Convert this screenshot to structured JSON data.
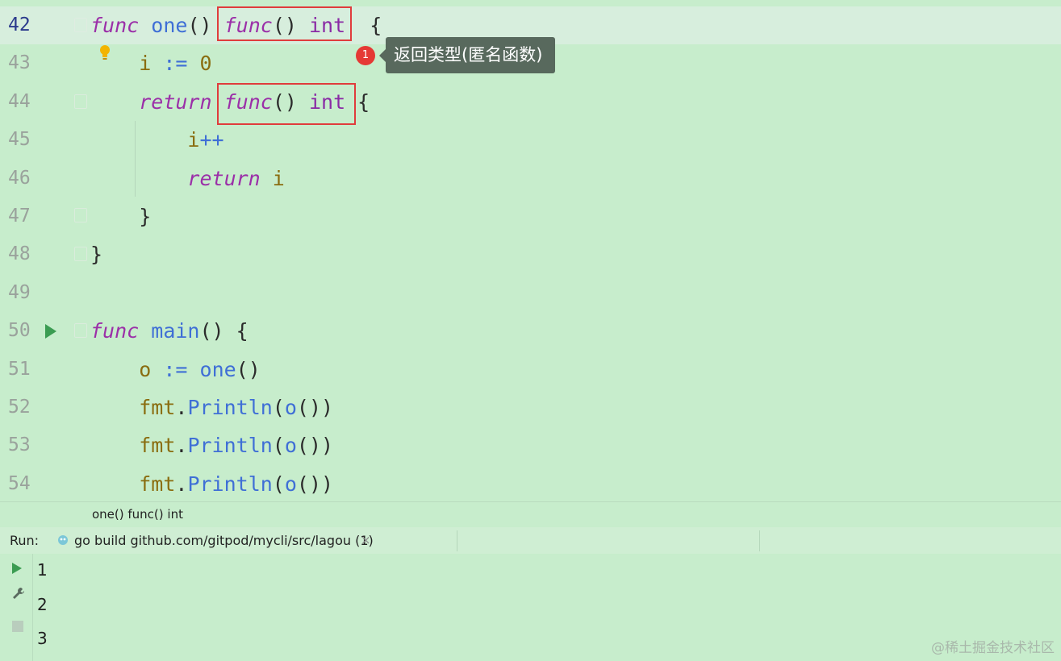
{
  "editor": {
    "lines": [
      {
        "num": "42",
        "tokens": [
          [
            "kw",
            "func"
          ],
          [
            "pl",
            " "
          ],
          [
            "fn",
            "one"
          ],
          [
            "pl",
            "() "
          ],
          [
            "kw",
            "func"
          ],
          [
            "pl",
            "() "
          ],
          [
            "ty",
            "int"
          ],
          [
            "pl",
            "  {"
          ]
        ]
      },
      {
        "num": "43",
        "tokens": [
          [
            "pl",
            "    "
          ],
          [
            "va",
            "i"
          ],
          [
            "pl",
            " "
          ],
          [
            "op",
            ":="
          ],
          [
            "pl",
            " "
          ],
          [
            "va",
            "0"
          ]
        ]
      },
      {
        "num": "44",
        "tokens": [
          [
            "pl",
            "    "
          ],
          [
            "kw",
            "return"
          ],
          [
            "pl",
            " "
          ],
          [
            "kw",
            "func"
          ],
          [
            "pl",
            "() "
          ],
          [
            "ty",
            "int"
          ],
          [
            "pl",
            " {"
          ]
        ]
      },
      {
        "num": "45",
        "tokens": [
          [
            "pl",
            "        "
          ],
          [
            "va",
            "i"
          ],
          [
            "op",
            "++"
          ]
        ]
      },
      {
        "num": "46",
        "tokens": [
          [
            "pl",
            "        "
          ],
          [
            "kw",
            "return"
          ],
          [
            "pl",
            " "
          ],
          [
            "va",
            "i"
          ]
        ]
      },
      {
        "num": "47",
        "tokens": [
          [
            "pl",
            "    }"
          ]
        ]
      },
      {
        "num": "48",
        "tokens": [
          [
            "pl",
            "}"
          ]
        ]
      },
      {
        "num": "49",
        "tokens": []
      },
      {
        "num": "50",
        "tokens": [
          [
            "kw",
            "func"
          ],
          [
            "pl",
            " "
          ],
          [
            "fn",
            "main"
          ],
          [
            "pl",
            "() {"
          ]
        ]
      },
      {
        "num": "51",
        "tokens": [
          [
            "pl",
            "    "
          ],
          [
            "va",
            "o"
          ],
          [
            "pl",
            " "
          ],
          [
            "op",
            ":="
          ],
          [
            "pl",
            " "
          ],
          [
            "fn",
            "one"
          ],
          [
            "pl",
            "()"
          ]
        ]
      },
      {
        "num": "52",
        "tokens": [
          [
            "pl",
            "    "
          ],
          [
            "va",
            "fmt"
          ],
          [
            "pl",
            "."
          ],
          [
            "fn",
            "Println"
          ],
          [
            "pl",
            "("
          ],
          [
            "fn",
            "o"
          ],
          [
            "pl",
            "())"
          ]
        ]
      },
      {
        "num": "53",
        "tokens": [
          [
            "pl",
            "    "
          ],
          [
            "va",
            "fmt"
          ],
          [
            "pl",
            "."
          ],
          [
            "fn",
            "Println"
          ],
          [
            "pl",
            "("
          ],
          [
            "fn",
            "o"
          ],
          [
            "pl",
            "())"
          ]
        ]
      },
      {
        "num": "54",
        "tokens": [
          [
            "pl",
            "    "
          ],
          [
            "va",
            "fmt"
          ],
          [
            "pl",
            "."
          ],
          [
            "fn",
            "Println"
          ],
          [
            "pl",
            "("
          ],
          [
            "fn",
            "o"
          ],
          [
            "pl",
            "())"
          ]
        ]
      }
    ]
  },
  "annotation": {
    "badge": "1",
    "tooltip": "返回类型(匿名函数)"
  },
  "breadcrumb": "one() func() int",
  "run": {
    "label": "Run:",
    "tab_label": "go build github.com/gitpod/mycli/src/lagou (1)",
    "close": "×",
    "output": [
      "1",
      "2",
      "3"
    ]
  },
  "watermark": "@稀土掘金技术社区",
  "colors": {
    "background": "#c7edcc",
    "current_line": "#d7eedd",
    "keyword": "#9b2fa8",
    "function": "#3f6fd6",
    "variable": "#8a6d10",
    "highlight_box": "#e03c3c",
    "tooltip_bg": "#58695d",
    "badge": "#e53935"
  }
}
